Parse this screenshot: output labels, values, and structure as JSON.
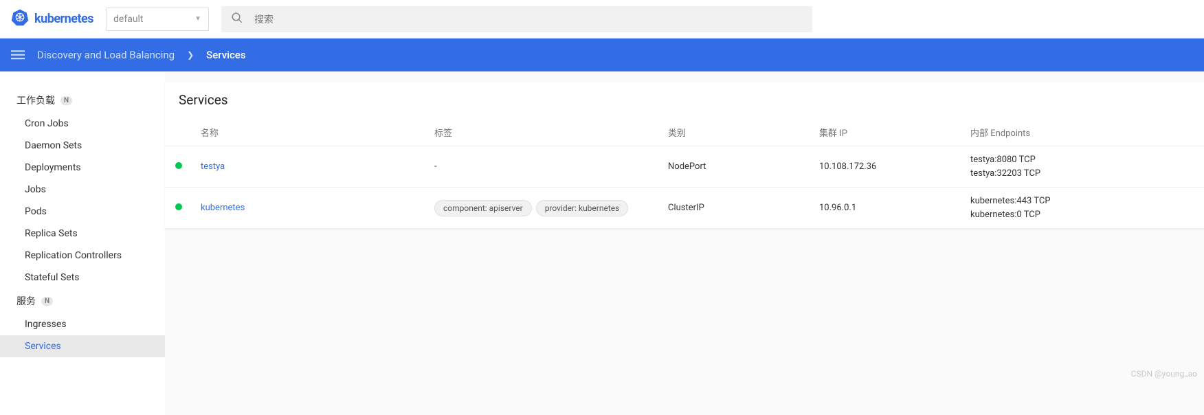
{
  "header": {
    "brand": "kubernetes",
    "namespace_selected": "default",
    "search_placeholder": "搜索"
  },
  "breadcrumb": {
    "parent": "Discovery and Load Balancing",
    "current": "Services"
  },
  "sidebar": {
    "group1": {
      "label": "工作负载",
      "badge": "N"
    },
    "items1": [
      {
        "label": "Cron Jobs"
      },
      {
        "label": "Daemon Sets"
      },
      {
        "label": "Deployments"
      },
      {
        "label": "Jobs"
      },
      {
        "label": "Pods"
      },
      {
        "label": "Replica Sets"
      },
      {
        "label": "Replication Controllers"
      },
      {
        "label": "Stateful Sets"
      }
    ],
    "group2": {
      "label": "服务",
      "badge": "N"
    },
    "items2": [
      {
        "label": "Ingresses"
      },
      {
        "label": "Services",
        "active": true
      }
    ]
  },
  "card": {
    "title": "Services",
    "columns": {
      "name": "名称",
      "labels": "标签",
      "type": "类别",
      "cluster_ip": "集群 IP",
      "endpoints": "内部 Endpoints"
    },
    "rows": [
      {
        "status": "green",
        "name": "testya",
        "labels_text": "-",
        "labels": [],
        "type": "NodePort",
        "cluster_ip": "10.108.172.36",
        "endpoints": [
          "testya:8080 TCP",
          "testya:32203 TCP"
        ]
      },
      {
        "status": "green",
        "name": "kubernetes",
        "labels_text": "",
        "labels": [
          "component: apiserver",
          "provider: kubernetes"
        ],
        "type": "ClusterIP",
        "cluster_ip": "10.96.0.1",
        "endpoints": [
          "kubernetes:443 TCP",
          "kubernetes:0 TCP"
        ]
      }
    ]
  },
  "watermark": "CSDN @young_ao"
}
